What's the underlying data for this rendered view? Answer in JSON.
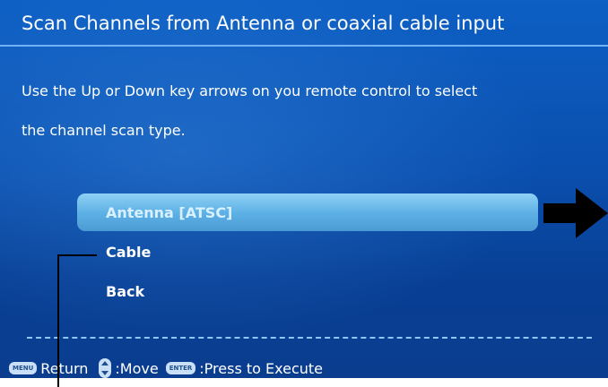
{
  "screen": {
    "title": "Scan Channels from Antenna or coaxial cable input",
    "instruction_line1": "Use the Up or Down key arrows on you remote control to select",
    "instruction_line2": "the channel scan type."
  },
  "menu": {
    "items": [
      {
        "label": "Antenna [ATSC]",
        "selected": true
      },
      {
        "label": "Cable",
        "selected": false
      },
      {
        "label": "Back",
        "selected": false
      }
    ]
  },
  "footer": {
    "menu_key": "MENU",
    "return_label": "Return",
    "move_label": ":Move",
    "enter_key": "ENTER",
    "execute_label": ":Press to Execute"
  },
  "icons": {
    "up_down": "up-down-key-icon",
    "pointer": "right-arrow-icon"
  },
  "colors": {
    "background": "#0a4fae",
    "highlight": "#5fb2e6",
    "text": "#ffffff"
  }
}
